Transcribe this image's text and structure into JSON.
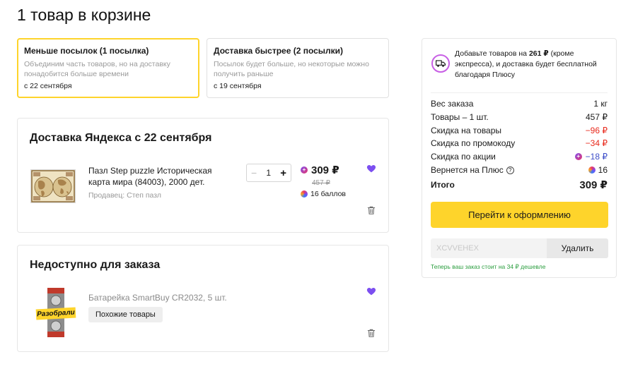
{
  "page": {
    "title": "1 товар в корзине"
  },
  "delivery_options": [
    {
      "title": "Меньше посылок (1 посылка)",
      "description": "Объединим часть товаров, но на доставку понадобится больше времени",
      "date": "с 22 сентября",
      "selected": true
    },
    {
      "title": "Доставка быстрее (2 посылки)",
      "description": "Посылок будет больше, но некоторые можно получить раньше",
      "date": "с 19 сентября",
      "selected": false
    }
  ],
  "shipment": {
    "title": "Доставка Яндекса с 22 сентября",
    "item": {
      "name": "Пазл Step puzzle Историческая карта мира (84003), 2000 дет.",
      "seller": "Продавец: Степ пазл",
      "quantity": "1",
      "minus": "−",
      "plus": "+",
      "price": "309 ₽",
      "old_price": "457 ₽",
      "bonus": "16 баллов"
    }
  },
  "unavailable": {
    "title": "Недоступно для заказа",
    "item": {
      "name": "Батарейка SmartBuy CR2032, 5 шт.",
      "badge": "Разобрали",
      "similar_button": "Похожие товары"
    }
  },
  "summary": {
    "promo_text_prefix": "Добавьте товаров на",
    "promo_amount": "261 ₽",
    "promo_text_suffix": "(кроме экспресса), и доставка будет бесплатной благодаря Плюсу",
    "rows": [
      {
        "label": "Вес заказа",
        "value": "1 кг"
      },
      {
        "label": "Товары – 1 шт.",
        "value": "457 ₽"
      },
      {
        "label": "Скидка на товары",
        "value": "−96 ₽"
      },
      {
        "label": "Скидка по промокоду",
        "value": "−34 ₽"
      },
      {
        "label": "Скидка по акции",
        "value": "−18 ₽"
      },
      {
        "label": "Вернется на Плюс",
        "value": "16"
      }
    ],
    "total_label": "Итого",
    "total_value": "309 ₽",
    "checkout_button": "Перейти к оформлению",
    "promo_code": "XCVVEHEX",
    "remove_button": "Удалить",
    "promo_note": "Теперь ваш заказ стоит на 34 ₽ дешевле"
  },
  "colors": {
    "accent_yellow": "#fed42b",
    "discount_red": "#e8291c",
    "plus_blue": "#3d4ec9",
    "favorite_purple": "#7c4ff0",
    "note_green": "#2a9d3e"
  },
  "icons": {
    "favorite": "heart-icon",
    "delete": "trash-icon",
    "delivery": "delivery-truck-icon",
    "plus": "plus-points-icon",
    "help": "question-icon"
  }
}
